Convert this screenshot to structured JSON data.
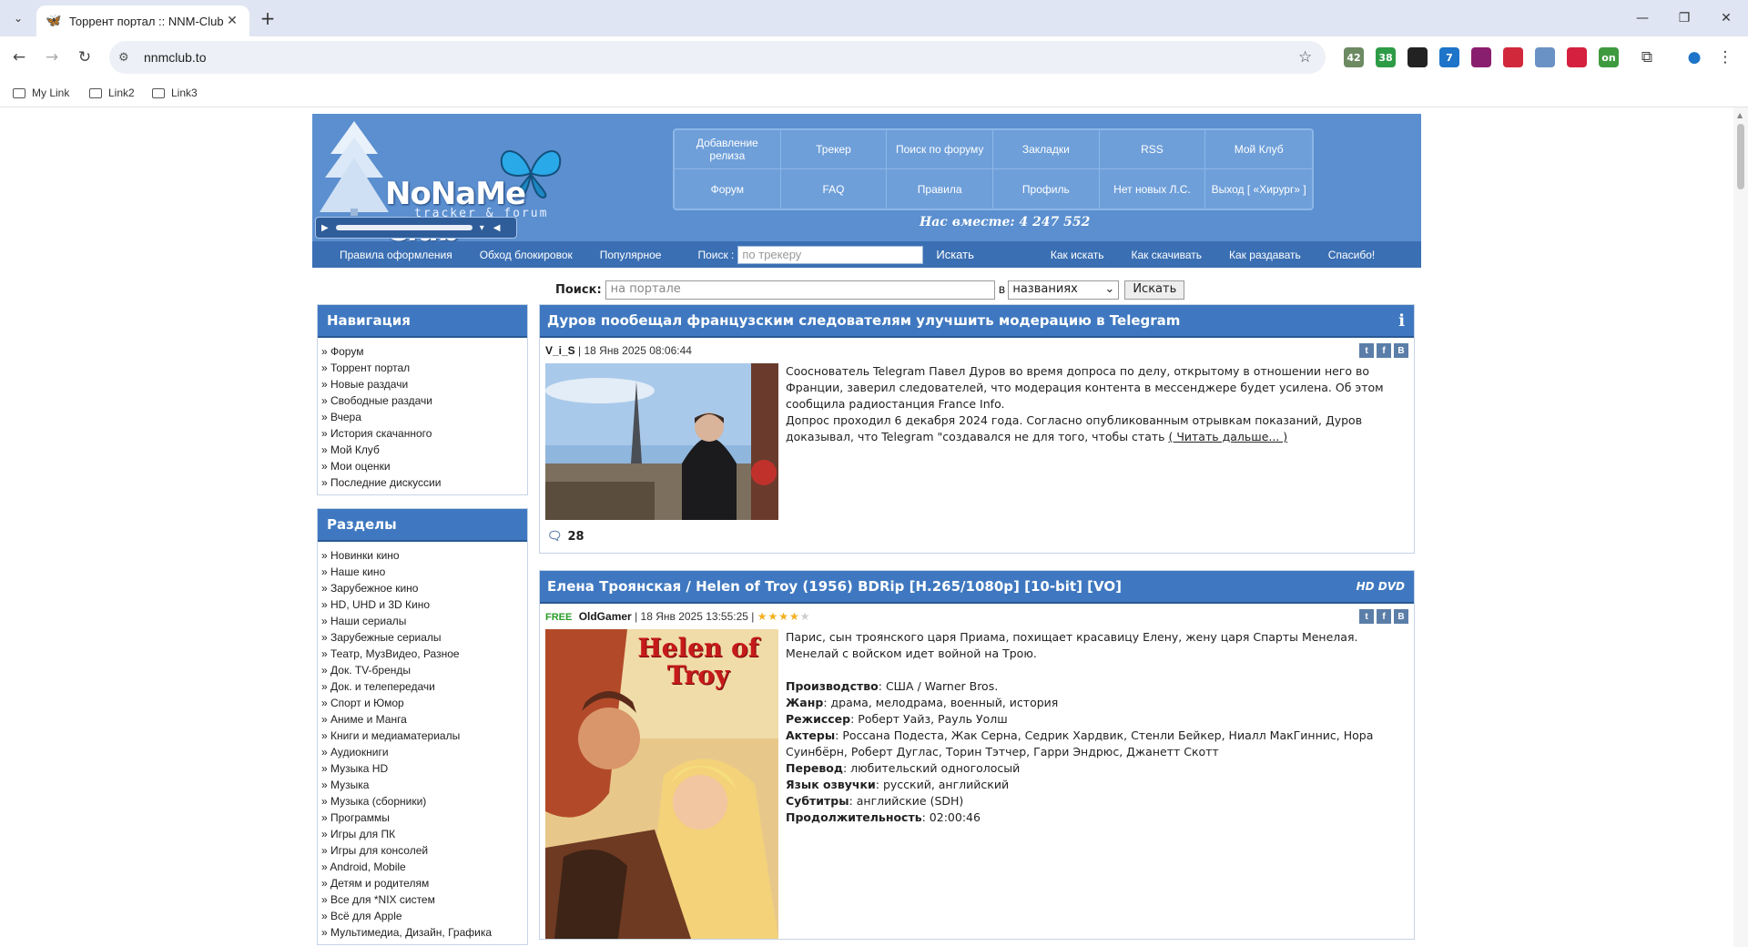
{
  "browser": {
    "tab_title": "Торрент портал :: NNM-Club",
    "url": "nnmclub.to",
    "bookmarks": [
      "My Link",
      "Link2",
      "Link3"
    ],
    "extensions": [
      {
        "icon": "ext-42-icon",
        "badge": "42",
        "color": "#6d8a63"
      },
      {
        "icon": "ext-38-icon",
        "badge": "38",
        "color": "#2e9b47"
      },
      {
        "icon": "ext-grid-icon",
        "badge": "",
        "color": "#222222"
      },
      {
        "icon": "ext-7-icon",
        "badge": "7",
        "color": "#1d74c9"
      },
      {
        "icon": "ext-block-icon",
        "badge": "",
        "color": "#8a1e6e"
      },
      {
        "icon": "ext-shield-icon",
        "badge": "",
        "color": "#d2283b"
      },
      {
        "icon": "ext-share-icon",
        "badge": "",
        "color": "#6a92c5"
      },
      {
        "icon": "ext-red-icon",
        "badge": "",
        "color": "#d62040"
      },
      {
        "icon": "ext-on-icon",
        "badge": "on",
        "color": "#3f9a3f"
      }
    ]
  },
  "site": {
    "logo_text": "NoNaMe Club",
    "logo_sub": "tracker & forum",
    "together": "Нас вместе: 4 247 552",
    "topnav": [
      "Добавление релиза",
      "Трекер",
      "Поиск по форуму",
      "Закладки",
      "RSS",
      "Мой Клуб",
      "Форум",
      "FAQ",
      "Правила",
      "Профиль",
      "Нет новых Л.С.",
      "Выход [ «Хирург» ]"
    ],
    "subnav": {
      "links_left": [
        "Правила оформления",
        "Обход блокировок",
        "Популярное"
      ],
      "search_label": "Поиск :",
      "search_placeholder": "по трекеру",
      "search_button": "Искать",
      "links_right": [
        "Как искать",
        "Как скачивать",
        "Как раздавать",
        "Спасибо!"
      ]
    },
    "portal_search": {
      "label": "Поиск:",
      "placeholder": "на портале",
      "in": "в",
      "select_value": "названиях",
      "button": "Искать"
    }
  },
  "sidebar": {
    "nav_title": "Навигация",
    "nav_items": [
      "» Форум",
      "» Торрент портал",
      "» Новые раздачи",
      "» Свободные раздачи",
      "» Вчера",
      "» История скачанного",
      "» Мой Клуб",
      "» Мои оценки",
      "» Последние дискуссии"
    ],
    "sections_title": "Разделы",
    "section_items": [
      "» Новинки кино",
      "» Наше кино",
      "» Зарубежное кино",
      "» HD, UHD и 3D Кино",
      "» Наши сериалы",
      "» Зарубежные сериалы",
      "» Театр, МузВидео, Разное",
      "» Док. TV-бренды",
      "» Док. и телепередачи",
      "» Спорт и Юмор",
      "» Аниме и Манга",
      "» Книги и медиаматериалы",
      "» Аудиокниги",
      "» Музыка HD",
      "» Музыка",
      "» Музыка (сборники)",
      "» Программы",
      "» Игры для ПК",
      "» Игры для консолей",
      "» Android, Mobile",
      "» Детям и родителям",
      "» Все для *NIX систем",
      "» Всё для Apple",
      "» Мультимедиа, Дизайн, Графика"
    ]
  },
  "posts": [
    {
      "title": "Дуров пообещал французским следователям улучшить модерацию в Telegram",
      "author": "V_i_S",
      "date": "| 18 Янв 2025 08:06:44",
      "text1": "Сооснователь Telegram Павел Дуров во время допроса по делу, открытому в отношении него во Франции, заверил следователей, что модерация контента в мессенджере будет усилена. Об этом сообщила радиостанция France Info.",
      "text2": "Допрос проходил 6 декабря 2024 года. Согласно опубликованным отрывкам показаний, Дуров доказывал, что Telegram \"создавался не для того, чтобы стать",
      "read_more": "( Читать дальше... )",
      "comments": "28"
    },
    {
      "title": "Елена Троянская / Helen of Troy (1956) BDRip [H.265/1080p] [10-bit] [VO]",
      "badge": "HD DVD",
      "free": "FREE",
      "author": "OldGamer",
      "date": "| 18 Янв 2025 13:55:25 |",
      "rating": 4,
      "poster_title": "Helen of Troy",
      "description": "Парис, сын троянского царя Приама, похищает красавицу Елену, жену царя Спарты Менелая. Менелай с войском идет войной на Трою.",
      "fields": [
        {
          "k": "Производство",
          "v": ": США / Warner Bros."
        },
        {
          "k": "Жанр",
          "v": ": драма, мелодрама, военный, история"
        },
        {
          "k": "Режиссер",
          "v": ": Роберт Уайз, Рауль Уолш"
        },
        {
          "k": "Актеры",
          "v": ": Россана Подеста, Жак Серна, Седрик Хардвик, Стенли Бейкер, Ниалл МакГиннис, Нора Суинбёрн, Роберт Дуглас, Торин Тэтчер, Гарри Эндрюс, Джанетт Скотт"
        },
        {
          "k": "Перевод",
          "v": ": любительский одноголосый"
        },
        {
          "k": "Язык озвучки",
          "v": ": русский, английский"
        },
        {
          "k": "Субтитры",
          "v": ": английские (SDH)"
        },
        {
          "k": "Продолжительность",
          "v": ": 02:00:46"
        }
      ]
    }
  ]
}
